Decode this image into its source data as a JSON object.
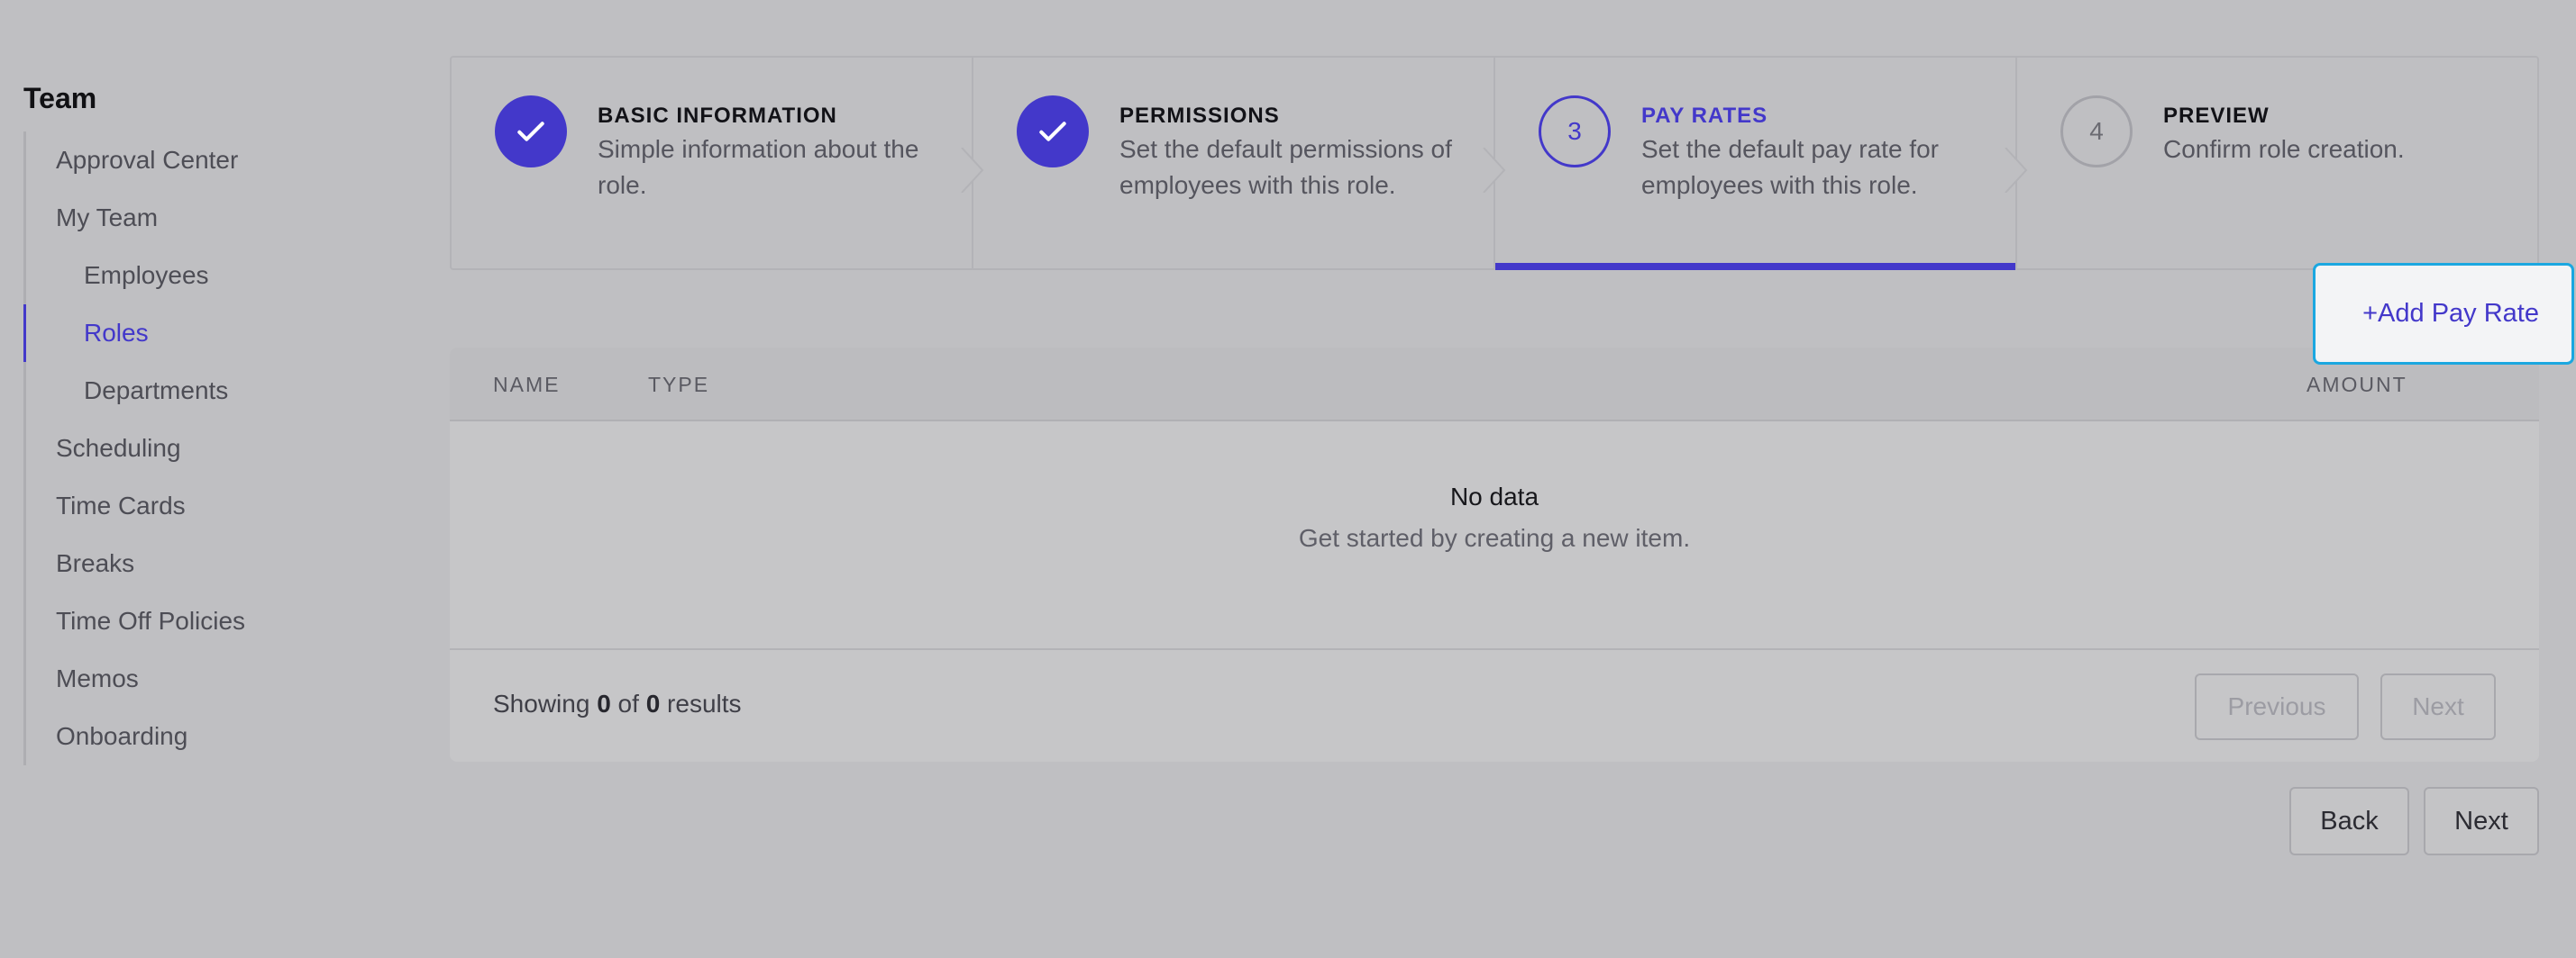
{
  "sidebar": {
    "title": "Team",
    "items": [
      {
        "label": "Approval Center"
      },
      {
        "label": "My Team"
      },
      {
        "label": "Employees"
      },
      {
        "label": "Roles"
      },
      {
        "label": "Departments"
      },
      {
        "label": "Scheduling"
      },
      {
        "label": "Time Cards"
      },
      {
        "label": "Breaks"
      },
      {
        "label": "Time Off Policies"
      },
      {
        "label": "Memos"
      },
      {
        "label": "Onboarding"
      }
    ],
    "active_item": "Roles"
  },
  "stepper": {
    "steps": [
      {
        "number": "1",
        "title": "BASIC INFORMATION",
        "description": "Simple information about the role.",
        "status": "complete",
        "icon": "check-icon"
      },
      {
        "number": "2",
        "title": "PERMISSIONS",
        "description": "Set the default permissions of employees with this role.",
        "status": "complete",
        "icon": "check-icon"
      },
      {
        "number": "3",
        "title": "PAY RATES",
        "description": "Set the default pay rate for employees with this role.",
        "status": "current"
      },
      {
        "number": "4",
        "title": "PREVIEW",
        "description": "Confirm role creation.",
        "status": "upcoming"
      }
    ]
  },
  "add_button": {
    "label": "+Add Pay Rate"
  },
  "table": {
    "columns": [
      "NAME",
      "TYPE",
      "AMOUNT"
    ],
    "rows": [],
    "empty_title": "No data",
    "empty_description": "Get started by creating a new item.",
    "footer": {
      "prefix": "Showing",
      "from": "0",
      "middle": "of",
      "total": "0",
      "suffix": "results"
    },
    "pagination": {
      "previous_label": "Previous",
      "next_label": "Next"
    }
  },
  "footer_nav": {
    "back_label": "Back",
    "next_label": "Next"
  },
  "colors": {
    "accent": "#4338ca",
    "focus_ring": "#1ba7e0",
    "background": "#bfbfc2"
  }
}
